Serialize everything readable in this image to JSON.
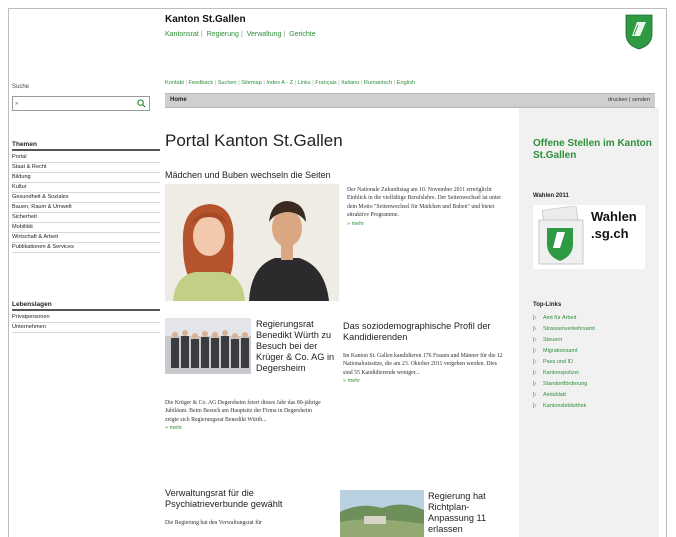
{
  "header": {
    "title": "Kanton St.Gallen",
    "org_nav": [
      "Kantonsrat",
      "Regierung",
      "Verwaltung",
      "Gerichte"
    ]
  },
  "search": {
    "label": "Suche",
    "value": "»"
  },
  "service_nav": [
    "Kontakt",
    "Feedback",
    "Suchen",
    "Sitemap",
    "Index A - Z",
    "Links",
    "Français",
    "Italiano",
    "Rumantsch",
    "English"
  ],
  "breadcrumb": "Home",
  "tools": {
    "print": "drucken",
    "send": "senden"
  },
  "sidebar": {
    "themen_title": "Themen",
    "themen": [
      "Portal",
      "Staat & Recht",
      "Bildung",
      "Kultur",
      "Gesundheit & Soziales",
      "Bauen, Raum & Umwelt",
      "Sicherheit",
      "Mobilität",
      "Wirtschaft & Arbeit",
      "Publikationen & Services"
    ],
    "lebenslagen_title": "Lebenslagen",
    "lebenslagen": [
      "Privatpersonen",
      "Unternehmen"
    ]
  },
  "main": {
    "page_title": "Portal Kanton St.Gallen",
    "feature": {
      "heading": "Mädchen und Buben wechseln die Seiten",
      "text": "Der Nationale Zukunftstag am 10. November 2011 ermöglicht Einblick in die vielfältige Berufslehre. Der Seitenwechsel ist unter dem Motto \"Seitenwechsel für Mädchen und Buben\" und bietet attraktive Programme.",
      "more": "» mehr"
    },
    "news": [
      {
        "title": "Regierungsrat Benedikt Würth zu Besuch bei der Krüger & Co. AG in Degersheim",
        "text": "Die Krüger & Co. AG Degersheim feiert dieses Jahr das 80-jährige Jubiläum. Beim Besuch am Hauptsitz der Firma in Degersheim zeigte sich Regierungsrat Benedikt Würth...",
        "more": "» mehr"
      },
      {
        "title": "Das soziodemographische Profil der Kandidierenden",
        "text": "Im Kanton St. Gallen kandidieren 176 Frauen und Männer für die 12 Nationalratssitze, die am 23. Oktober 2011 vergeben werden. Dies sind 55 Kandidierende weniger...",
        "more": "» mehr"
      },
      {
        "title": "Verwaltungsrat für die Psychiatrieverbunde gewählt",
        "text": "Die Regierung hat den Verwaltungsrat für"
      },
      {
        "title": "Regierung hat Richtplan-Anpassung 11 erlassen"
      }
    ]
  },
  "right": {
    "jobs_title": "Offene Stellen im Kanton St.Gallen",
    "wahlen_label": "Wahlen 2011",
    "wahlen_banner_line1": "Wahlen",
    "wahlen_banner_line2": ".sg.ch",
    "toplinks_label": "Top-Links",
    "toplinks": [
      "Amt für Arbeit",
      "Strassenverkehrsamt",
      "Steuern",
      "Migrationsamt",
      "Pass und ID",
      "Kantonspolizei",
      "Standortförderung",
      "Amtsblatt",
      "Kantonsbibliothek"
    ]
  },
  "colors": {
    "accent": "#2e8f3b",
    "bar": "#cfcfcf",
    "sidebar_right": "#f1f1f1"
  }
}
